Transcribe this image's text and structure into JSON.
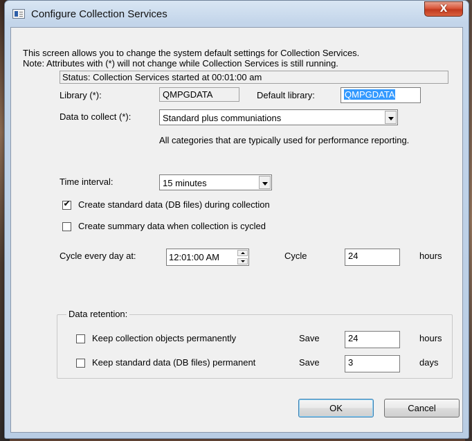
{
  "window": {
    "title": "Configure Collection Services",
    "close_label": "X"
  },
  "intro": {
    "line1": "This screen allows you to change the system default settings for Collection Services.",
    "line2": "Note: Attributes with (*) will not change while Collection Services is still running."
  },
  "status": {
    "text": "Status: Collection Services started at 00:01:00 am"
  },
  "library": {
    "label": "Library (*):",
    "value": "QMPGDATA",
    "default_label": "Default library:",
    "default_value": "QMPGDATA"
  },
  "data_to_collect": {
    "label": "Data to collect (*):",
    "selected": "Standard plus communiations",
    "description": "All categories that are typically used for performance reporting."
  },
  "time_interval": {
    "label": "Time interval:",
    "selected": "15 minutes"
  },
  "options": {
    "create_standard": {
      "label": "Create standard data (DB files) during collection",
      "checked": true,
      "mark": "✔"
    },
    "create_summary": {
      "label": "Create summary data when collection is cycled",
      "checked": false
    }
  },
  "cycle": {
    "label": "Cycle every day at:",
    "time": "12:01:00 AM",
    "cycle_label": "Cycle",
    "hours_value": "24",
    "hours_unit": "hours"
  },
  "retention": {
    "group_label": "Data retention:",
    "keep_objects": {
      "label": "Keep collection objects permanently",
      "checked": false,
      "save_label": "Save",
      "value": "24",
      "unit": "hours"
    },
    "keep_standard": {
      "label": "Keep standard data (DB files) permanent",
      "checked": false,
      "save_label": "Save",
      "value": "3",
      "unit": "days"
    }
  },
  "buttons": {
    "ok": "OK",
    "cancel": "Cancel"
  }
}
